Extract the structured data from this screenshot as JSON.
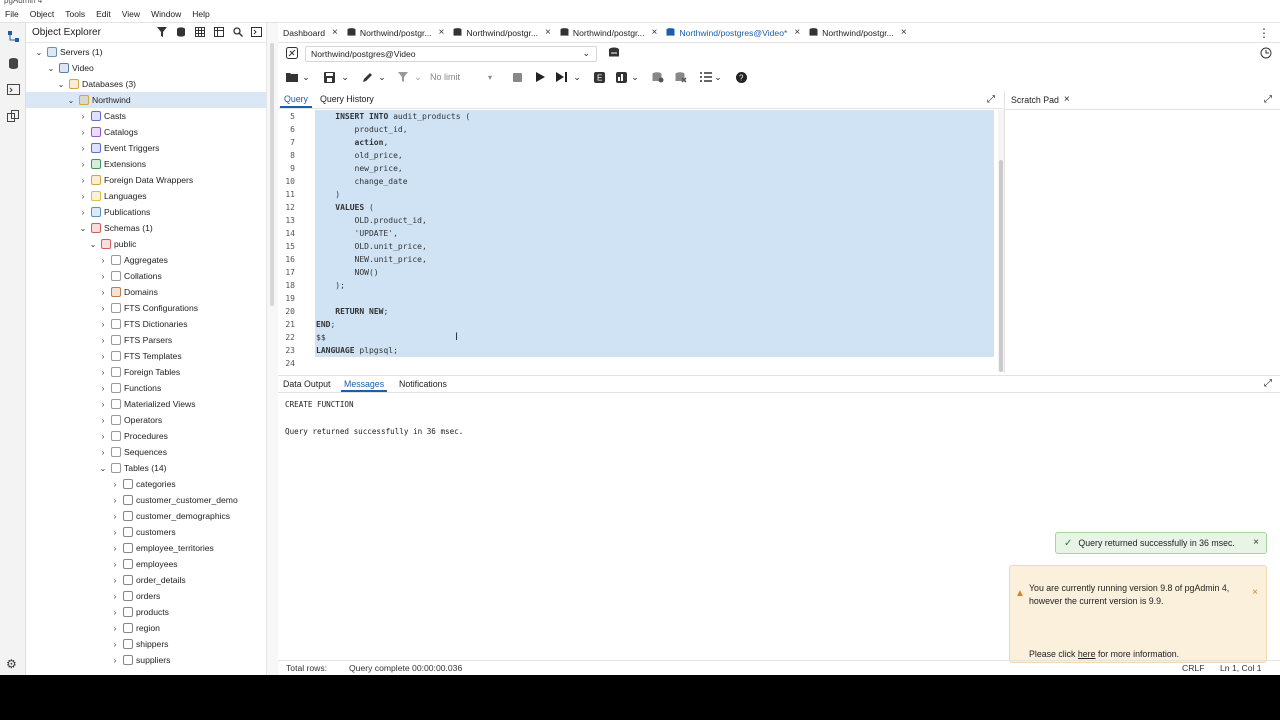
{
  "window": {
    "title": "pgAdmin 4"
  },
  "menu": [
    "File",
    "Object",
    "Tools",
    "Edit",
    "View",
    "Window",
    "Help"
  ],
  "explorer": {
    "title": "Object Explorer",
    "tree": [
      {
        "label": "Servers (1)",
        "arrow": "v",
        "icon": "servers-icon",
        "level": 0
      },
      {
        "label": "Video",
        "arrow": "v",
        "icon": "server-icon",
        "level": 1
      },
      {
        "label": "Databases (3)",
        "arrow": "v",
        "icon": "databases-icon",
        "level": 2
      },
      {
        "label": "Northwind",
        "arrow": "v",
        "icon": "database-icon",
        "level": 3,
        "selected": true
      },
      {
        "label": "Casts",
        "arrow": ">",
        "icon": "casts-icon",
        "level": 4
      },
      {
        "label": "Catalogs",
        "arrow": ">",
        "icon": "catalogs-icon",
        "level": 4
      },
      {
        "label": "Event Triggers",
        "arrow": ">",
        "icon": "event-triggers-icon",
        "level": 4
      },
      {
        "label": "Extensions",
        "arrow": ">",
        "icon": "extensions-icon",
        "level": 4
      },
      {
        "label": "Foreign Data Wrappers",
        "arrow": ">",
        "icon": "fdw-icon",
        "level": 4
      },
      {
        "label": "Languages",
        "arrow": ">",
        "icon": "languages-icon",
        "level": 4
      },
      {
        "label": "Publications",
        "arrow": ">",
        "icon": "publications-icon",
        "level": 4
      },
      {
        "label": "Schemas (1)",
        "arrow": "v",
        "icon": "schemas-icon",
        "level": 4
      },
      {
        "label": "public",
        "arrow": "v",
        "icon": "schema-icon",
        "level": 5
      },
      {
        "label": "Aggregates",
        "arrow": ">",
        "icon": "aggregates-icon",
        "level": 6
      },
      {
        "label": "Collations",
        "arrow": ">",
        "icon": "collations-icon",
        "level": 6
      },
      {
        "label": "Domains",
        "arrow": ">",
        "icon": "domains-icon",
        "level": 6
      },
      {
        "label": "FTS Configurations",
        "arrow": ">",
        "icon": "fts-config-icon",
        "level": 6
      },
      {
        "label": "FTS Dictionaries",
        "arrow": ">",
        "icon": "fts-dict-icon",
        "level": 6
      },
      {
        "label": "FTS Parsers",
        "arrow": ">",
        "icon": "fts-parsers-icon",
        "level": 6
      },
      {
        "label": "FTS Templates",
        "arrow": ">",
        "icon": "fts-templates-icon",
        "level": 6
      },
      {
        "label": "Foreign Tables",
        "arrow": ">",
        "icon": "foreign-tables-icon",
        "level": 6
      },
      {
        "label": "Functions",
        "arrow": ">",
        "icon": "functions-icon",
        "level": 6
      },
      {
        "label": "Materialized Views",
        "arrow": ">",
        "icon": "mviews-icon",
        "level": 6
      },
      {
        "label": "Operators",
        "arrow": ">",
        "icon": "operators-icon",
        "level": 6
      },
      {
        "label": "Procedures",
        "arrow": ">",
        "icon": "procedures-icon",
        "level": 6
      },
      {
        "label": "Sequences",
        "arrow": ">",
        "icon": "sequences-icon",
        "level": 6
      },
      {
        "label": "Tables (14)",
        "arrow": "v",
        "icon": "tables-icon",
        "level": 6
      },
      {
        "label": "categories",
        "arrow": ">",
        "icon": "table-icon",
        "level": 7
      },
      {
        "label": "customer_customer_demo",
        "arrow": ">",
        "icon": "table-icon",
        "level": 7
      },
      {
        "label": "customer_demographics",
        "arrow": ">",
        "icon": "table-icon",
        "level": 7
      },
      {
        "label": "customers",
        "arrow": ">",
        "icon": "table-icon",
        "level": 7
      },
      {
        "label": "employee_territories",
        "arrow": ">",
        "icon": "table-icon",
        "level": 7
      },
      {
        "label": "employees",
        "arrow": ">",
        "icon": "table-icon",
        "level": 7
      },
      {
        "label": "order_details",
        "arrow": ">",
        "icon": "table-icon",
        "level": 7
      },
      {
        "label": "orders",
        "arrow": ">",
        "icon": "table-icon",
        "level": 7
      },
      {
        "label": "products",
        "arrow": ">",
        "icon": "table-icon",
        "level": 7
      },
      {
        "label": "region",
        "arrow": ">",
        "icon": "table-icon",
        "level": 7
      },
      {
        "label": "shippers",
        "arrow": ">",
        "icon": "table-icon",
        "level": 7
      },
      {
        "label": "suppliers",
        "arrow": ">",
        "icon": "table-icon",
        "level": 7
      }
    ]
  },
  "tabs": [
    {
      "label": "Dashboard",
      "active": false
    },
    {
      "label": "Northwind/postgr...",
      "active": false
    },
    {
      "label": "Northwind/postgr...",
      "active": false
    },
    {
      "label": "Northwind/postgr...",
      "active": false
    },
    {
      "label": "Northwind/postgres@Video*",
      "active": true
    },
    {
      "label": "Northwind/postgr...",
      "active": false
    }
  ],
  "connection": {
    "value": "Northwind/postgres@Video"
  },
  "toolbar": {
    "limit": "No limit"
  },
  "query_tabs": {
    "query": "Query",
    "history": "Query History"
  },
  "scratch": {
    "title": "Scratch Pad"
  },
  "editor": {
    "lines": [
      {
        "n": "5",
        "text": "    INSERT INTO audit_products (",
        "bold": [
          "INSERT",
          "INTO"
        ]
      },
      {
        "n": "6",
        "text": "        product_id,"
      },
      {
        "n": "7",
        "text": "        action,",
        "bold": [
          "action"
        ]
      },
      {
        "n": "8",
        "text": "        old_price,"
      },
      {
        "n": "9",
        "text": "        new_price,"
      },
      {
        "n": "10",
        "text": "        change_date"
      },
      {
        "n": "11",
        "text": "    )"
      },
      {
        "n": "12",
        "text": "    VALUES (",
        "bold": [
          "VALUES"
        ]
      },
      {
        "n": "13",
        "text": "        OLD.product_id,"
      },
      {
        "n": "14",
        "text": "        'UPDATE',"
      },
      {
        "n": "15",
        "text": "        OLD.unit_price,"
      },
      {
        "n": "16",
        "text": "        NEW.unit_price,"
      },
      {
        "n": "17",
        "text": "        NOW()"
      },
      {
        "n": "18",
        "text": "    );"
      },
      {
        "n": "19",
        "text": ""
      },
      {
        "n": "20",
        "text": "    RETURN NEW;",
        "bold": [
          "RETURN",
          "NEW"
        ]
      },
      {
        "n": "21",
        "text": "END;",
        "bold": [
          "END"
        ]
      },
      {
        "n": "22",
        "text": "$$"
      },
      {
        "n": "23",
        "text": "LANGUAGE plpgsql;",
        "bold": [
          "LANGUAGE"
        ]
      },
      {
        "n": "24",
        "text": ""
      }
    ]
  },
  "output": {
    "tabs": [
      "Data Output",
      "Messages",
      "Notifications"
    ],
    "active_tab": "Messages",
    "line1": "CREATE FUNCTION",
    "line2": "Query returned successfully in 36 msec."
  },
  "toast": {
    "text": "Query returned successfully in 36 msec."
  },
  "notice": {
    "line1": "You are currently running version 9.8 of pgAdmin 4,",
    "line2": "however the current version is 9.9.",
    "line3_pre": "Please click ",
    "line3_link": "here",
    "line3_post": " for more information."
  },
  "status": {
    "total_rows": "Total rows:",
    "query_complete": "Query complete 00:00:00.036",
    "eol": "CRLF",
    "position": "Ln 1, Col 1"
  },
  "colors": {
    "accent": "#1a5fa8",
    "selection": "#cfe3f5",
    "toast_bg": "#e8f4e6",
    "notice_bg": "#fbf0dc"
  }
}
